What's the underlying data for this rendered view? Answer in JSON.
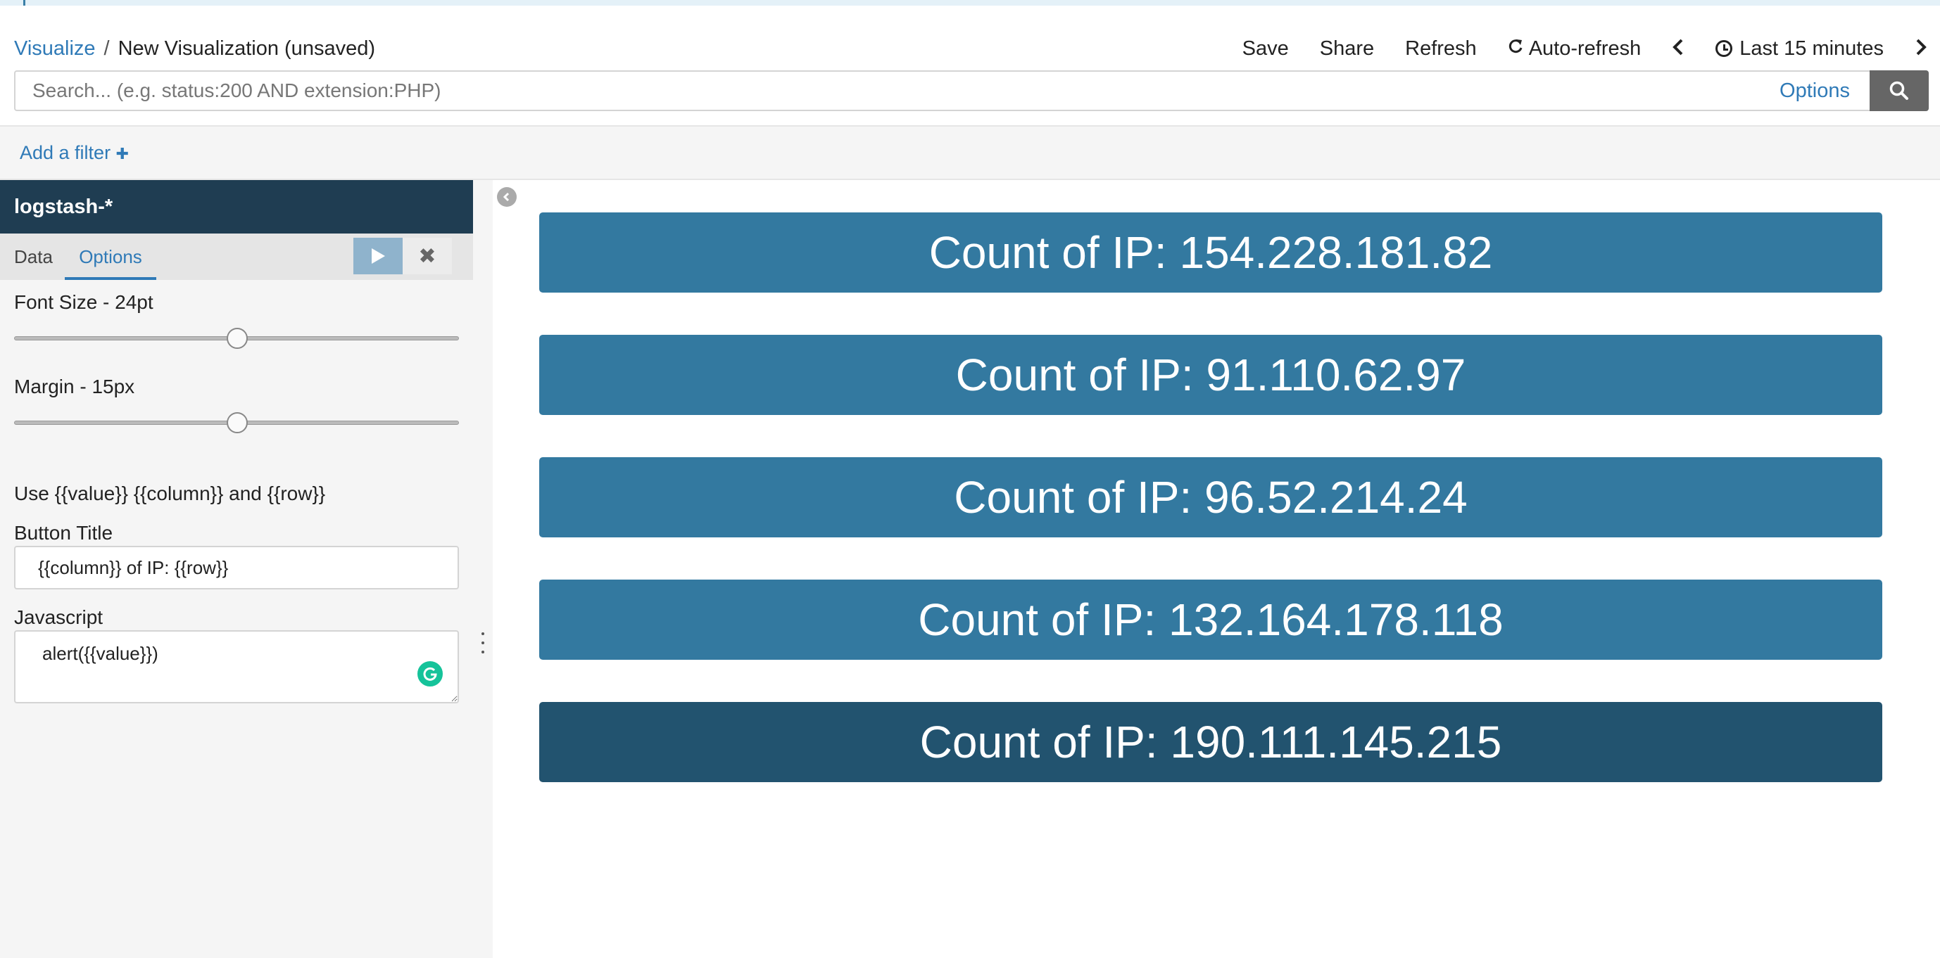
{
  "breadcrumb": {
    "root": "Visualize",
    "separator": "/",
    "current": "New Visualization (unsaved)"
  },
  "top_nav": {
    "save": "Save",
    "share": "Share",
    "refresh": "Refresh",
    "auto_refresh": "Auto-refresh",
    "time_range": "Last 15 minutes",
    "icons": [
      "refresh-icon",
      "chevron-left-icon",
      "clock-icon",
      "chevron-right-icon"
    ]
  },
  "search": {
    "placeholder": "Search... (e.g. status:200 AND extension:PHP)",
    "value": "",
    "options_label": "Options",
    "icon": "search-icon"
  },
  "filter": {
    "add_label": "Add a filter",
    "plus_glyph": "✚"
  },
  "sidebar": {
    "index_pattern": "logstash-*",
    "tabs": [
      {
        "label": "Data",
        "active": false
      },
      {
        "label": "Options",
        "active": true
      }
    ],
    "apply_icon": "play-icon",
    "discard_glyph": "✖",
    "font_size_label": "Font Size - 24pt",
    "font_size_slider": 0.5,
    "margin_label": "Margin - 15px",
    "margin_slider": 0.5,
    "help_text": "Use {{value}} {{column}} and {{row}}",
    "button_title_label": "Button Title",
    "button_title_value": "{{column}} of IP: {{row}}",
    "javascript_label": "Javascript",
    "javascript_value": "alert({{value}})"
  },
  "visualization": {
    "buttons": [
      {
        "label": "Count of IP: 154.228.181.82",
        "active": false
      },
      {
        "label": "Count of IP: 91.110.62.97",
        "active": false
      },
      {
        "label": "Count of IP: 96.52.214.24",
        "active": false
      },
      {
        "label": "Count of IP: 132.164.178.118",
        "active": false
      },
      {
        "label": "Count of IP: 190.111.145.215",
        "active": true
      }
    ],
    "colors": {
      "button": "#3379a0",
      "button_active": "#22536f"
    }
  },
  "colors": {
    "link": "#2f7ab7",
    "sidebar_header": "#1f3d52",
    "search_button": "#666666"
  }
}
